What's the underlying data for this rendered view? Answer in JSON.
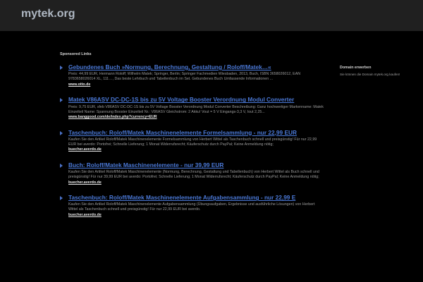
{
  "site": {
    "logo": "mytek.org"
  },
  "sponsored_label": "Sponsored Links",
  "ads": [
    {
      "title": "Gebundenes Buch »Normung, Berechnung, Gestaltung / Roloff/Matek…«",
      "desc": "Preis: 44,99 EUR, Hermann Roloff; Wilhelm Matek; Springer, Berlin; Springer Fachmedien Wiesbaden, 2013, Buch, ISBN 3658026012, EAN 9783658026014 XL, 111…, Das beste Lehrbuch und Tabellenbuch im Set. Gebundenes Buch Umfassende Informationen ...",
      "url": "www.otto.de"
    },
    {
      "title": "Matek V86ASV DC-DC-1S bis zu 5V Voltage Booster Verordnung Modul Converter",
      "desc": "Preis: 9,75 EUR, sfeb V86ASV DC-DC-1S bis zu 5V Voltage Booster Verordnung Modul Converter Beschreibung: Ganz hochwertiger Markenname: Matek Einzelteil Name: Spannung Booster Einzelteil Nr.: V86ASV Gleichstrom: 2 Akku! Vout = 5 V Eingangs-3,3 V, Iout 2,25...",
      "url": "www.banggood.com/de/index.php?currency=EUR"
    },
    {
      "title": "Taschenbuch: Roloff/Matek Maschinenelemente Formelsammlung - nur 22,99 EUR",
      "desc": "Kaufen Sie den Artikel Roloff/Matek Maschinenelemente Formelsammlung von Herbert Wittel als Taschenbuch schnell und preisgünstig! Für nur 22,99 EUR bei averdo: Portofrei; Schnelle Lieferung; 1 Monat Widerrufsrecht; Käuferschutz durch PayPal; Keine Anmeldung nötig;",
      "url": "buecher.averdo.de"
    },
    {
      "title": "Buch: Roloff/Matek Maschinenelemente - nur 39,99 EUR",
      "desc": "Kaufen Sie den Artikel Roloff/Matek Maschinenelemente (Normung, Berechnung, Gestaltung und Tabellenbuch) von Herbert Wittel als Buch schnell und preisgünstig! Für nur 39,99 EUR bei averdo: Portofrei; Schnelle Lieferung; 1 Monat Widerrufsrecht; Käuferschutz durch PayPal; Keine Anmeldung nötig;",
      "url": "buecher.averdo.de"
    },
    {
      "title": "Taschenbuch: Roloff/Matek Maschinenelemente Aufgabensammlung - nur 22,99 E",
      "desc": "Kaufen Sie den Artikel Roloff/Matek Maschinenelemente Aufgabensammlung (Übungsaufgaben, Ergebnisse und ausführliche Lösungen) von Herbert Wittel als Taschenbuch schnell und preisgünstig! Für nur 22,99 EUR bei averdo.",
      "url": "buecher.averdo.de"
    }
  ],
  "sidebar": {
    "title": "Domain erwerben",
    "text": "Sie können die Domain mytek.org kaufen!"
  },
  "colors": {
    "background": "#000000",
    "topbar": "#202020",
    "link": "#4a78d6"
  }
}
